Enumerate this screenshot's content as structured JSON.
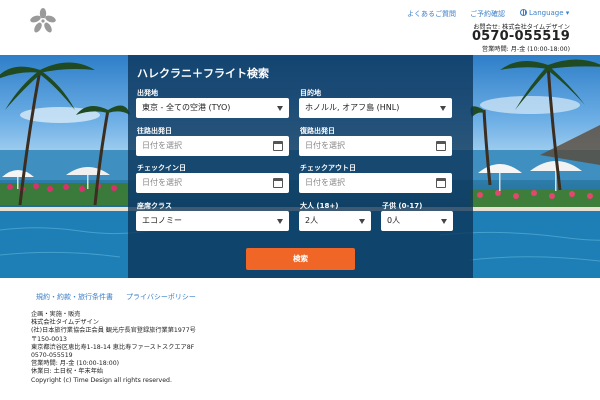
{
  "header": {
    "logo": "orchid-logo",
    "nav": {
      "faq": "よくあるご質問",
      "reservation_confirm": "ご予約確認",
      "language": "Language ▾"
    },
    "contact": {
      "label": "お問合せ: 株式会社タイムデザイン",
      "phone": "0570-055519",
      "hours": "営業時間: 月-金 (10:00-18:00)"
    }
  },
  "form": {
    "title": "ハレクラニ＋フライト検索",
    "departure": {
      "label": "出発地",
      "value": "東京 - 全ての空港 (TYO)"
    },
    "destination": {
      "label": "目的地",
      "value": "ホノルル, オアフ島 (HNL)"
    },
    "outbound_date": {
      "label": "往路出発日",
      "placeholder": "日付を選択"
    },
    "return_date": {
      "label": "復路出発日",
      "placeholder": "日付を選択"
    },
    "checkin": {
      "label": "チェックイン日",
      "placeholder": "日付を選択"
    },
    "checkout": {
      "label": "チェックアウト日",
      "placeholder": "日付を選択"
    },
    "seat_class": {
      "label": "座席クラス",
      "value": "エコノミー"
    },
    "adults": {
      "label": "大人 (18+)",
      "value": "2人"
    },
    "children": {
      "label": "子供 (0-17)",
      "value": "0人"
    },
    "search_label": "検索"
  },
  "footer": {
    "links": {
      "terms": "規約・約款・旅行条件書",
      "privacy": "プライバシーポリシー"
    },
    "lines": [
      "企画・実施・販売",
      "株式会社タイムデザイン",
      "(社)日本旅行業協会正会員 観光庁長官登録旅行業第1977号",
      "〒150-0013",
      "東京都渋谷区恵比寿1-18-14 恵比寿ファーストスクエア8F",
      "0570-055519",
      "営業時間: 月-金 (10:00-18:00)",
      "休業日: 土日祝・年末年始",
      "Copyright (c) Time Design all rights reserved."
    ]
  },
  "colors": {
    "accent": "#ef6627",
    "link": "#3a7fc9",
    "panel": "#0c3458"
  }
}
